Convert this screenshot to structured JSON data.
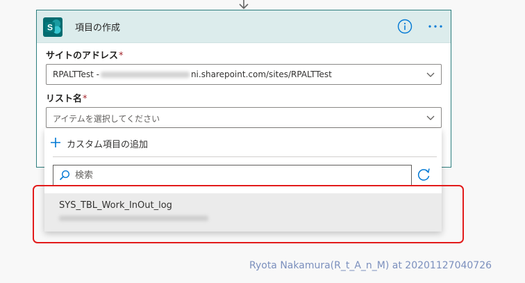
{
  "card": {
    "title": "項目の作成",
    "logo_icon": "sharepoint-logo-icon",
    "logo_letter": "S",
    "info_icon": "info-icon",
    "more_icon": "more-options-icon"
  },
  "site_field": {
    "label": "サイトのアドレス",
    "required_mark": "*",
    "value_prefix": "RPALTTest -",
    "value_suffix": "ni.sharepoint.com/sites/RPALTTest"
  },
  "list_field": {
    "label": "リスト名",
    "required_mark": "*",
    "placeholder": "アイテムを選択してください"
  },
  "dropdown": {
    "add_custom_label": "カスタム項目の追加",
    "search_placeholder": "検索",
    "items": [
      {
        "name": "SYS_TBL_Work_InOut_log"
      }
    ]
  },
  "watermark": "Ryota Nakamura(R_t_A_n_M) at 20201127040726",
  "colors": {
    "accent": "#0078d4",
    "card_header": "#dcecec",
    "card_border": "#2c7d7d",
    "highlight": "#e21b1b",
    "sharepoint": "#036c70"
  }
}
